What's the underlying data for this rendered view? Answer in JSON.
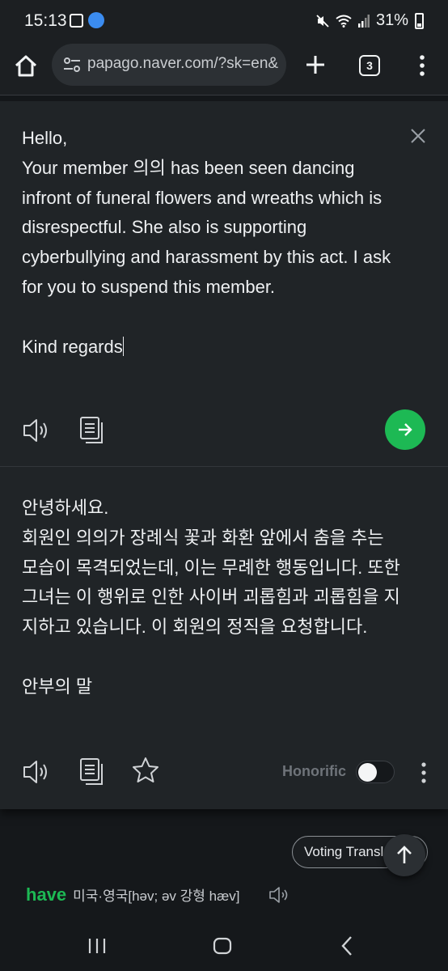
{
  "status_bar": {
    "time": "15:13",
    "battery": "31%",
    "icons": [
      "gallery-icon",
      "edge-icon",
      "mute-icon",
      "wifi-icon",
      "signal-icon",
      "battery-icon"
    ]
  },
  "browser": {
    "url": "papago.naver.com/?sk=en&",
    "tab_count": "3",
    "icons": [
      "home-icon",
      "tune-icon",
      "plus-icon",
      "tabs-icon",
      "more-vert-icon"
    ]
  },
  "source": {
    "text": "Hello,\nYour member 의의 has been seen dancing infront of funeral flowers and wreaths which is disrespectful. She also is supporting cyberbullying and harassment by this act. I ask for you to suspend this member.\n\nKind regards",
    "icons": [
      "close-icon",
      "speaker-icon",
      "copy-icon",
      "arrow-right-icon"
    ]
  },
  "translation": {
    "text": "안녕하세요.\n회원인 의의가 장례식 꽃과 화환 앞에서 춤을 추는 모습이 목격되었는데, 이는 무례한 행동입니다. 또한 그녀는 이 행위로 인한 사이버 괴롭힘과 괴롭힘을 지지하고 있습니다. 이 회원의 정직을 요청합니다.\n\n안부의 말",
    "honorific_label": "Honorific",
    "honorific_on": false,
    "icons": [
      "speaker-icon",
      "copy-icon",
      "star-icon",
      "more-vert-icon"
    ]
  },
  "voting": {
    "label": "Voting Transl"
  },
  "dictionary": {
    "word": "have",
    "pronunciation": "미국·영국[həv; əv 강형 hæv]"
  },
  "nav_bar": {
    "icons": [
      "recents-icon",
      "home-nav-icon",
      "back-icon"
    ]
  },
  "colors": {
    "accent_green": "#1db954",
    "background": "#15181b",
    "card": "#202427"
  }
}
